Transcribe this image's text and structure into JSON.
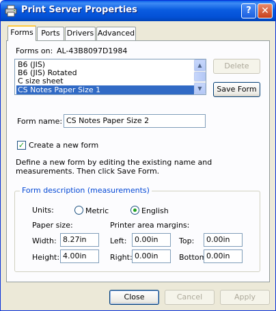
{
  "window": {
    "title": "Print Server Properties",
    "help_glyph": "?",
    "close_glyph": "✕"
  },
  "tabs": [
    {
      "label": "Forms",
      "active": true
    },
    {
      "label": "Ports",
      "active": false
    },
    {
      "label": "Drivers",
      "active": false
    },
    {
      "label": "Advanced",
      "active": false
    }
  ],
  "forms_on": {
    "label": "Forms on:",
    "value": "AL-43B8097D1984"
  },
  "forms_list": {
    "items": [
      "B6 (JIS)",
      "B6 (JIS) Rotated",
      "C size sheet",
      "CS Notes Paper Size 1"
    ],
    "selected": "CS Notes Paper Size 1"
  },
  "buttons": {
    "delete": "Delete",
    "save_form": "Save Form",
    "close": "Close",
    "cancel": "Cancel",
    "apply": "Apply"
  },
  "form_name": {
    "label": "Form name:",
    "value": "CS Notes Paper Size 2"
  },
  "create_new": {
    "label": "Create a new form",
    "checked": true
  },
  "instructions": {
    "line1": "Define a new form by editing the existing name and",
    "line2": "measurements.  Then click Save Form."
  },
  "measurements": {
    "group_title": "Form description (measurements)",
    "units_label": "Units:",
    "metric_label": "Metric",
    "english_label": "English",
    "selected_unit": "English",
    "paper_size_label": "Paper size:",
    "margins_label": "Printer area margins:",
    "width_label": "Width:",
    "width_value": "8.27in",
    "height_label": "Height:",
    "height_value": "4.00in",
    "left_label": "Left:",
    "left_value": "0.00in",
    "right_label": "Right:",
    "right_value": "0.00in",
    "top_label": "Top:",
    "top_value": "0.00in",
    "bottom_label": "Bottom:",
    "bottom_value": "0.00in"
  },
  "icons": {
    "title_icon": "printer-icon",
    "scroll_up": "▲",
    "scroll_down": "▼",
    "check": "✓"
  }
}
